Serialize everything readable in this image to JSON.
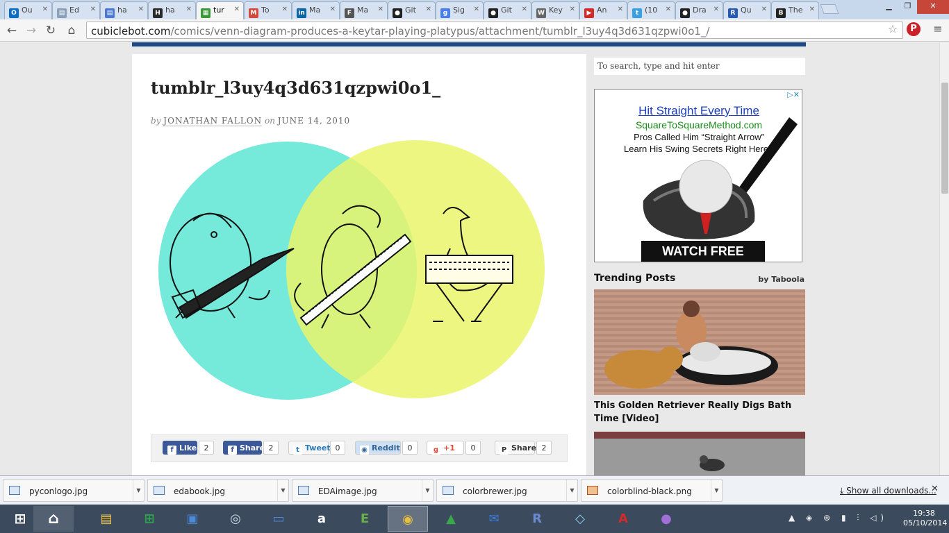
{
  "tabs": [
    {
      "label": "Ou",
      "icon": "O",
      "color": "#0b6ec5"
    },
    {
      "label": "Ed",
      "icon": "▤",
      "color": "#8aa0b8"
    },
    {
      "label": "ha",
      "icon": "▤",
      "color": "#4b78d1"
    },
    {
      "label": "ha",
      "icon": "H",
      "color": "#2a2a2a"
    },
    {
      "label": "tur",
      "icon": "▦",
      "color": "#3a9a3a",
      "active": true
    },
    {
      "label": "To",
      "icon": "M",
      "color": "#d44a3a"
    },
    {
      "label": "Ma",
      "icon": "in",
      "color": "#0a66a8"
    },
    {
      "label": "Ma",
      "icon": "F",
      "color": "#555555"
    },
    {
      "label": "Git",
      "icon": "●",
      "color": "#222222"
    },
    {
      "label": "Sig",
      "icon": "g",
      "color": "#4a80e8"
    },
    {
      "label": "Git",
      "icon": "●",
      "color": "#222222"
    },
    {
      "label": "Key",
      "icon": "W",
      "color": "#666666"
    },
    {
      "label": "An",
      "icon": "▶",
      "color": "#d42a2a"
    },
    {
      "label": "(10",
      "icon": "t",
      "color": "#3aa0e0"
    },
    {
      "label": "Dra",
      "icon": "●",
      "color": "#222222"
    },
    {
      "label": "Qu",
      "icon": "R",
      "color": "#2a5ab0"
    },
    {
      "label": "The",
      "icon": "B",
      "color": "#222222"
    }
  ],
  "address": {
    "host": "cubiclebot.com",
    "path": "/comics/venn-diagram-produces-a-keytar-playing-platypus/attachment/tumblr_l3uy4q3d631qzpwi0o1_/"
  },
  "article": {
    "title": "tumblr_l3uy4q3d631qzpwi0o1_",
    "by": "by",
    "author": "JONATHAN FALLON",
    "on": "on",
    "date": "JUNE 14, 2010"
  },
  "share": [
    {
      "label": "Like",
      "count": "2",
      "icon": "f",
      "bg": "#3b5998",
      "fg": "#ffffff"
    },
    {
      "label": "Share",
      "count": "2",
      "icon": "f",
      "bg": "#3b5998",
      "fg": "#ffffff"
    },
    {
      "label": "Tweet",
      "count": "0",
      "icon": "t",
      "bg": "#f7f7f7",
      "fg": "#2a7ab8"
    },
    {
      "label": "Reddit",
      "count": "0",
      "icon": "◉",
      "bg": "#cfe0f2",
      "fg": "#336699"
    },
    {
      "label": "+1",
      "count": "0",
      "icon": "g",
      "bg": "#ffffff",
      "fg": "#dd4b39"
    },
    {
      "label": "Share",
      "count": "2",
      "icon": "P",
      "bg": "#f7f7f7",
      "fg": "#333333"
    }
  ],
  "sidebar": {
    "search_placeholder": "To search, type and hit enter",
    "ad": {
      "line1": "Hit Straight Every Time",
      "line2": "SquareToSquareMethod.com",
      "line3": "Pros Called Him “Straight Arrow”",
      "line4": "Learn His Swing Secrets Right Here!”",
      "cta": "WATCH FREE LESSONS",
      "ad_icons": "▷✕"
    },
    "trending_heading": "Trending Posts",
    "trending_by": "by Taboola",
    "trending_items": [
      {
        "title": "This Golden Retriever Really Digs Bath Time [Video]"
      }
    ]
  },
  "downloads": [
    {
      "name": "pyconlogo.jpg"
    },
    {
      "name": "edabook.jpg"
    },
    {
      "name": "EDAimage.jpg"
    },
    {
      "name": "colorbrewer.jpg"
    },
    {
      "name": "colorblind-black.png"
    }
  ],
  "downloads_show_all": "Show all downloads...",
  "taskbar": {
    "apps": [
      {
        "name": "file-explorer",
        "glyph": "▤",
        "color": "#f4c542"
      },
      {
        "name": "store",
        "glyph": "⊞",
        "color": "#2aa84a"
      },
      {
        "name": "remote-desktop",
        "glyph": "▣",
        "color": "#4a8ad8"
      },
      {
        "name": "app-circle",
        "glyph": "◎",
        "color": "#cfd8e8"
      },
      {
        "name": "messages",
        "glyph": "▭",
        "color": "#4a8ad8"
      },
      {
        "name": "amazon",
        "glyph": "a",
        "color": "#ffffff"
      },
      {
        "name": "evernote",
        "glyph": "E",
        "color": "#6ab04a"
      },
      {
        "name": "chrome",
        "glyph": "◉",
        "color": "#e8c040"
      },
      {
        "name": "drive",
        "glyph": "▲",
        "color": "#3aa84a"
      },
      {
        "name": "mail",
        "glyph": "✉",
        "color": "#3a7ad8"
      },
      {
        "name": "r-language",
        "glyph": "R",
        "color": "#6a8ad0"
      },
      {
        "name": "notes",
        "glyph": "◇",
        "color": "#8ad0e8"
      },
      {
        "name": "pdf-reader",
        "glyph": "A",
        "color": "#d42a2a"
      },
      {
        "name": "github",
        "glyph": "●",
        "color": "#a070d8"
      }
    ],
    "tray": "▲ ◈ ⊕ ▮ ⫶ ◁)",
    "time": "19:38",
    "date": "05/10/2014"
  }
}
